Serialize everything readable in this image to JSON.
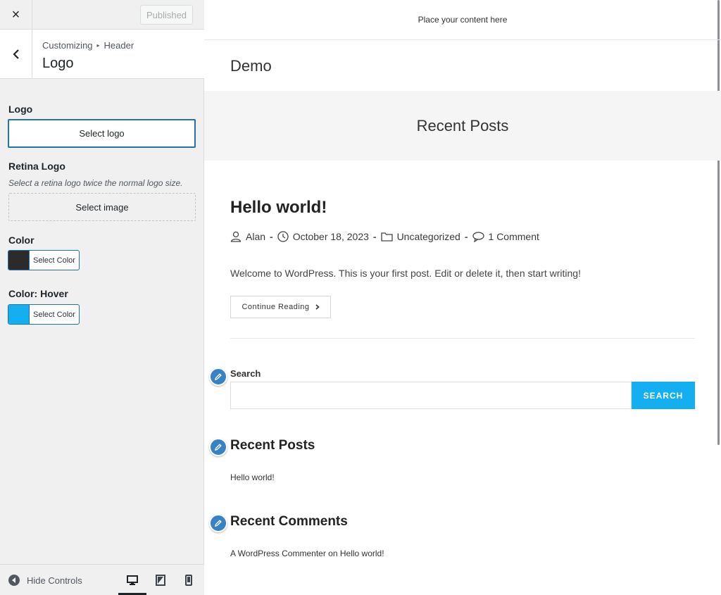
{
  "sidebar": {
    "close_icon": "×",
    "published_label": "Published",
    "breadcrumb": {
      "parent": "Customizing",
      "sep": "▸",
      "current": "Header"
    },
    "section_title": "Logo",
    "logo": {
      "label": "Logo",
      "button": "Select logo"
    },
    "retina": {
      "label": "Retina Logo",
      "description": "Select a retina logo twice the normal logo size.",
      "button": "Select image"
    },
    "color": {
      "label": "Color",
      "button": "Select Color",
      "swatch": "#2b2b2b"
    },
    "color_hover": {
      "label": "Color: Hover",
      "button": "Select Color",
      "swatch": "#13aff0"
    },
    "footer": {
      "hide_label": "Hide Controls"
    }
  },
  "preview": {
    "topline": "Place your content here",
    "site_title": "Demo",
    "page_header": "Recent Posts",
    "post": {
      "title": "Hello world!",
      "author": "Alan",
      "date": "October 18, 2023",
      "category": "Uncategorized",
      "comments": "1 Comment",
      "excerpt": "Welcome to WordPress. This is your first post. Edit or delete it, then start writing!",
      "continue": "Continue Reading"
    },
    "search_widget": {
      "label": "Search",
      "placeholder": "",
      "button": "SEARCH"
    },
    "recent_posts_widget": {
      "title": "Recent Posts",
      "item": "Hello world!"
    },
    "recent_comments_widget": {
      "title": "Recent Comments",
      "author": "A WordPress Commenter",
      "on": "on",
      "post": "Hello world!"
    }
  },
  "colors": {
    "accent": "#13aff0",
    "wp_blue": "#2271b1",
    "pencil": "#3582c4"
  }
}
